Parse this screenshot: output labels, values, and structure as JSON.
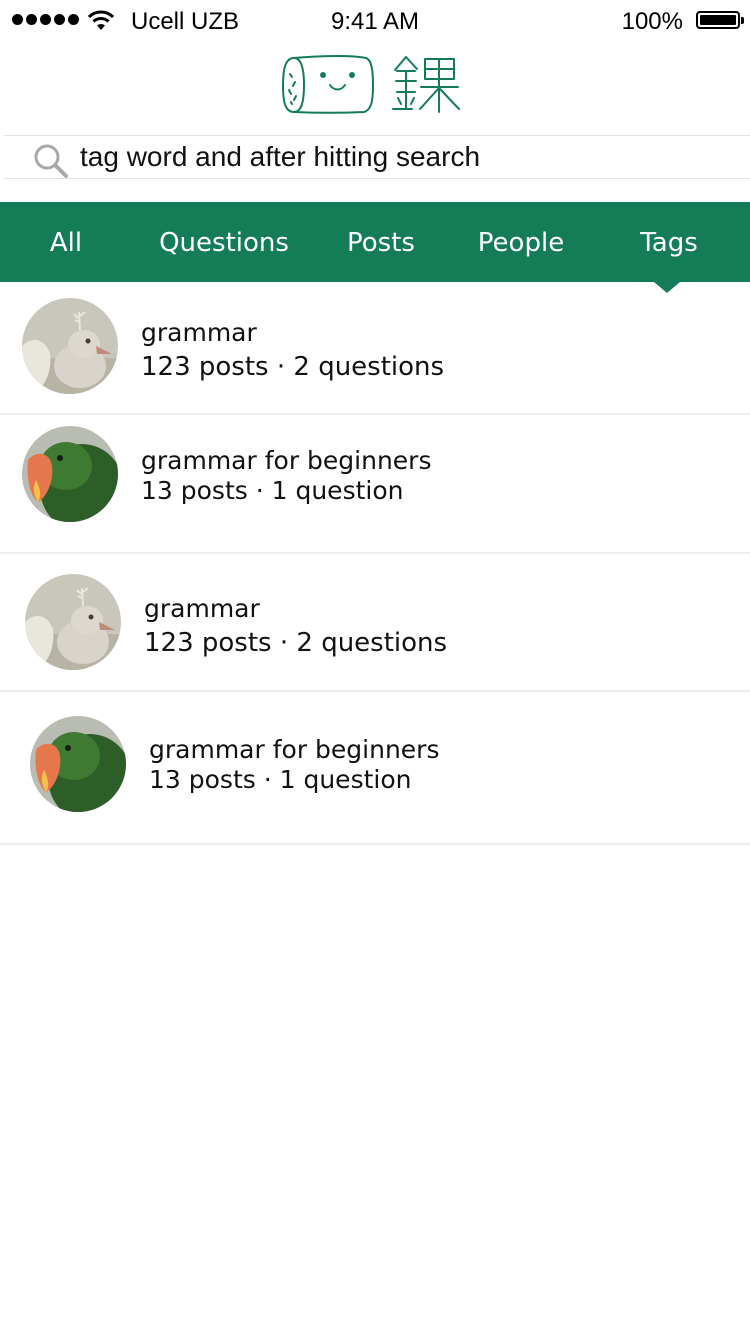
{
  "status_bar": {
    "carrier": "Ucell UZB",
    "time": "9:41 AM",
    "battery": "100%"
  },
  "search": {
    "value": "tag word and after hitting search",
    "icon": "search-icon"
  },
  "tabs": [
    {
      "label": "All",
      "selected": false
    },
    {
      "label": "Questions",
      "selected": false
    },
    {
      "label": "Posts",
      "selected": false
    },
    {
      "label": "People",
      "selected": false
    },
    {
      "label": "Tags",
      "selected": true
    }
  ],
  "tags": [
    {
      "name": "grammar",
      "stats": "123 posts · 2 questions",
      "avatar": "pigeon"
    },
    {
      "name": "grammar for beginners",
      "stats": "13 posts · 1 question",
      "avatar": "parrot"
    },
    {
      "name": "grammar",
      "stats": "123 posts · 2 questions",
      "avatar": "pigeon"
    },
    {
      "name": "grammar for beginners",
      "stats": "13 posts · 1 question",
      "avatar": "parrot"
    }
  ],
  "colors": {
    "accent": "#147d57",
    "divider": "#eeeeee"
  }
}
